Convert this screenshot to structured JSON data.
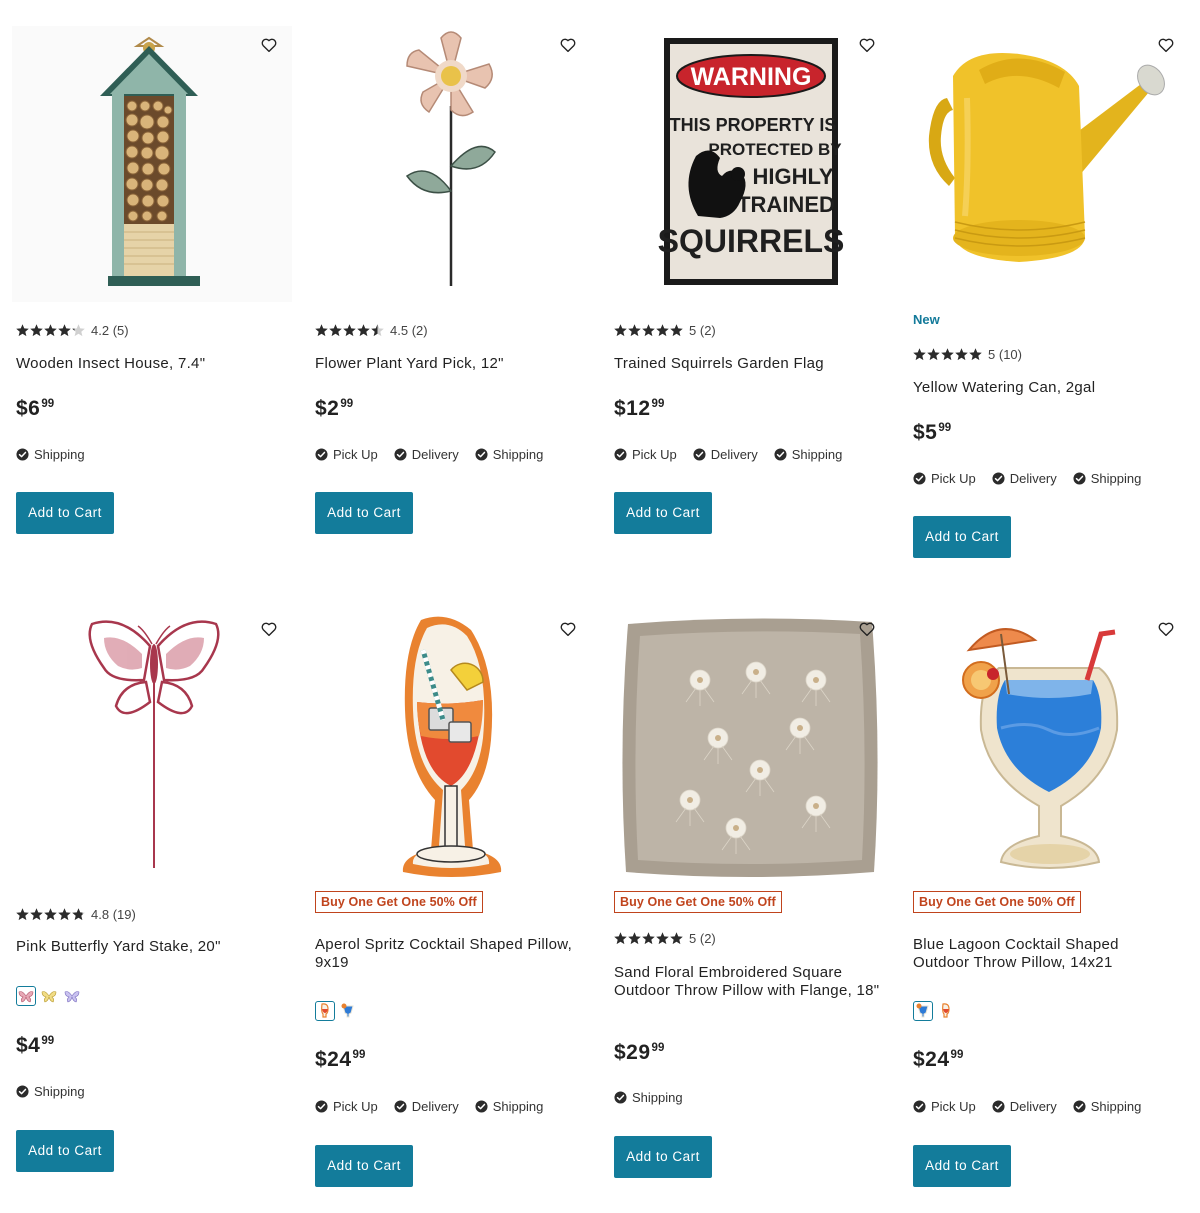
{
  "colors": {
    "accent": "#137c9b",
    "promo": "#c0441d",
    "new_badge": "#137a9a"
  },
  "products": [
    {
      "title": "Wooden Insect House, 7.4\"",
      "rating": 4.2,
      "rating_text": "4.2",
      "reviews": "(5)",
      "price_dollars": "$6",
      "price_cents": "99",
      "fulfillment": [
        "Shipping"
      ],
      "button": "Add to Cart",
      "image": "insect-house"
    },
    {
      "title": "Flower Plant Yard Pick, 12\"",
      "rating": 4.5,
      "rating_text": "4.5",
      "reviews": "(2)",
      "price_dollars": "$2",
      "price_cents": "99",
      "fulfillment": [
        "Pick Up",
        "Delivery",
        "Shipping"
      ],
      "button": "Add to Cart",
      "image": "flower-pick"
    },
    {
      "title": "Trained Squirrels Garden Flag",
      "rating": 5,
      "rating_text": "5",
      "reviews": "(2)",
      "price_dollars": "$12",
      "price_cents": "99",
      "fulfillment": [
        "Pick Up",
        "Delivery",
        "Shipping"
      ],
      "button": "Add to Cart",
      "image": "squirrel-flag",
      "flag_text": {
        "warning": "WARNING",
        "line1": "THIS PROPERTY IS",
        "line2": "PROTECTED BY",
        "line3": "HIGHLY",
        "line4": "TRAINED",
        "line5": "SQUIRRELS"
      }
    },
    {
      "badge": "New",
      "title": "Yellow Watering Can, 2gal",
      "rating": 5,
      "rating_text": "5",
      "reviews": "(10)",
      "price_dollars": "$5",
      "price_cents": "99",
      "fulfillment": [
        "Pick Up",
        "Delivery",
        "Shipping"
      ],
      "button": "Add to Cart",
      "image": "watering-can"
    },
    {
      "title": "Pink Butterfly Yard Stake, 20\"",
      "rating": 4.8,
      "rating_text": "4.8",
      "reviews": "(19)",
      "price_dollars": "$4",
      "price_cents": "99",
      "swatches": [
        "pink-butterfly",
        "yellow-butterfly",
        "purple-butterfly"
      ],
      "fulfillment": [
        "Shipping"
      ],
      "button": "Add to Cart",
      "image": "butterfly-stake"
    },
    {
      "promo": "Buy One Get One 50% Off",
      "title": "Aperol Spritz Cocktail Shaped Pillow, 9x19",
      "price_dollars": "$24",
      "price_cents": "99",
      "swatches": [
        "aperol-pillow",
        "blue-lagoon-pillow"
      ],
      "fulfillment": [
        "Pick Up",
        "Delivery",
        "Shipping"
      ],
      "button": "Add to Cart",
      "image": "aperol-pillow"
    },
    {
      "promo": "Buy One Get One 50% Off",
      "title": "Sand Floral Embroidered Square Outdoor Throw Pillow with Flange, 18\"",
      "rating": 5,
      "rating_text": "5",
      "reviews": "(2)",
      "price_dollars": "$29",
      "price_cents": "99",
      "fulfillment": [
        "Shipping"
      ],
      "button": "Add to Cart",
      "image": "floral-pillow"
    },
    {
      "promo": "Buy One Get One 50% Off",
      "title": "Blue Lagoon Cocktail Shaped Outdoor Throw Pillow, 14x21",
      "price_dollars": "$24",
      "price_cents": "99",
      "swatches": [
        "blue-lagoon-pillow",
        "aperol-pillow"
      ],
      "fulfillment": [
        "Pick Up",
        "Delivery",
        "Shipping"
      ],
      "button": "Add to Cart",
      "image": "blue-lagoon-pillow"
    }
  ]
}
